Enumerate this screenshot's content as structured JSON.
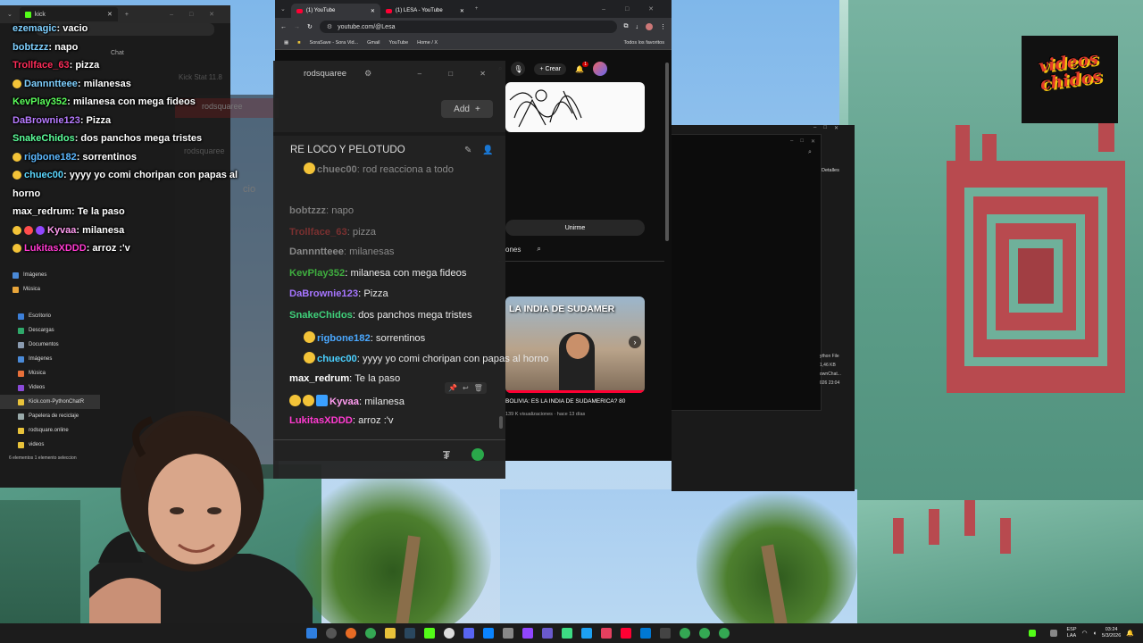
{
  "kick_window": {
    "tab_title": "kick",
    "chat_label": "Chat"
  },
  "file_explorer": {
    "items": [
      "Imágenes",
      "Música",
      "Escritorio",
      "Descargas",
      "Documentos",
      "Imágenes",
      "Música",
      "Videos",
      "Kick.com-PythonChatR",
      "Papelera de reciclaje",
      "rodsquare.online",
      "videos"
    ],
    "status": "6 elementos   1 elemento seleccion"
  },
  "overlay_chat": [
    {
      "user": "ezemagic",
      "message": "vacio",
      "color": "#7fd0ff",
      "badges": 0
    },
    {
      "user": "bobtzzz",
      "message": "napo",
      "color": "#7fd0ff",
      "badges": 0
    },
    {
      "user": "Trollface_63",
      "message": "pizza",
      "color": "#ff2d5a",
      "badges": 0
    },
    {
      "user": "Dannntteee",
      "message": "milanesas",
      "color": "#7fd0ff",
      "badges": 1
    },
    {
      "user": "KevPlay352",
      "message": "milanesa con mega fideos",
      "color": "#5cff5c",
      "badges": 0
    },
    {
      "user": "DaBrownie123",
      "message": "Pizza",
      "color": "#b77bff",
      "badges": 0
    },
    {
      "user": "SnakeChidos",
      "message": "dos panchos mega tristes",
      "color": "#5cff9a",
      "badges": 0
    },
    {
      "user": "rigbone182",
      "message": "sorrentinos",
      "color": "#5cb8ff",
      "badges": 1
    },
    {
      "user": "chuec00",
      "message": "yyyy yo comi choripan con papas al",
      "color": "#5cd8ff",
      "badges": 1
    },
    {
      "user": "",
      "message": "horno",
      "color": "#ffffff",
      "badges": 0
    },
    {
      "user": "max_redrum",
      "message": "Te la paso",
      "color": "#ffffff",
      "badges": 0
    },
    {
      "user": "Kyvaa",
      "message": "milanesa",
      "color": "#ff9cf0",
      "badges": 3
    },
    {
      "user": "LukitasXDDD",
      "message": "arroz :'v",
      "color": "#ff3ad0",
      "badges": 1
    }
  ],
  "browser": {
    "tabs": [
      "(1) YouTube",
      "(1) LESA - YouTube"
    ],
    "url": "youtube.com/@Lesa",
    "bookmarks": [
      "SoraSave - Sora Vid...",
      "Gmail",
      "YouTube",
      "Home / X"
    ],
    "bookmarks_all": "Todos los favoritos",
    "create_label": "Crear",
    "notif_count": "1",
    "join_label": "Unirme",
    "tab_partial": "ones",
    "video": {
      "thumbnail_text": "LA INDIA DE SUDAMER",
      "title": "BOLIVIA: ES LA INDIA DE SUDAMERICA? 80",
      "meta": "139 K visualizaciones · hace 13 días"
    }
  },
  "chat_popout": {
    "tab_name": "rodsquaree",
    "add_label": "Add",
    "title": "RE LOCO Y PELOTUDO",
    "bg_channel": "rodsquaree",
    "bg_title": "Kick Stat 11.8",
    "messages": [
      {
        "user": "chuec00",
        "message": "rod reacciona a todo",
        "color": "#7a7a7a",
        "dim": true
      },
      {
        "user": "",
        "message": "cio",
        "color": "#7a7a7a",
        "dim": true
      },
      {
        "user": "bobtzzz",
        "message": "napo",
        "color": "#7a7a7a",
        "dim": true
      },
      {
        "user": "Trollface_63",
        "message": "pizza",
        "color": "#7a3030",
        "dim": true
      },
      {
        "user": "Dannntteee",
        "message": "milanesas",
        "color": "#8a8a8a",
        "dim": true
      },
      {
        "user": "KevPlay352",
        "message": "milanesa con mega fideos",
        "color": "#3fae3f",
        "dim": false
      },
      {
        "user": "DaBrownie123",
        "message": "Pizza",
        "color": "#a675ff",
        "dim": false
      },
      {
        "user": "SnakeChidos",
        "message": "dos panchos mega tristes",
        "color": "#3fd07a",
        "dim": false
      },
      {
        "user": "rigbone182",
        "message": "sorrentinos",
        "color": "#4aa8ff",
        "dim": false
      },
      {
        "user": "chuec00",
        "message": "yyyy yo comi choripan con papas al horno",
        "color": "#4ad0ff",
        "dim": false
      },
      {
        "user": "max_redrum",
        "message": "Te la paso",
        "color": "#ffffff",
        "dim": false
      },
      {
        "user": "Kyvaa",
        "message": "milanesa",
        "color": "#ff9cf0",
        "dim": false
      },
      {
        "user": "LukitasXDDD",
        "message": "arroz :'v",
        "color": "#ff3ad0",
        "dim": false
      }
    ]
  },
  "right_window": {
    "details_label": "Detalles",
    "file_lines": [
      "ython File",
      "1,46 KB",
      "ownChat...",
      "026 23:04"
    ]
  },
  "logo": {
    "line1": "videos",
    "line2": "chidos"
  },
  "taskbar": {
    "lang1": "ESP",
    "lang2": "LAA",
    "time": "03:24",
    "date": "5/3/2026"
  },
  "colors": {
    "kick_green": "#53fc18",
    "youtube_red": "#ff0033",
    "chat_bg": "#232323"
  }
}
